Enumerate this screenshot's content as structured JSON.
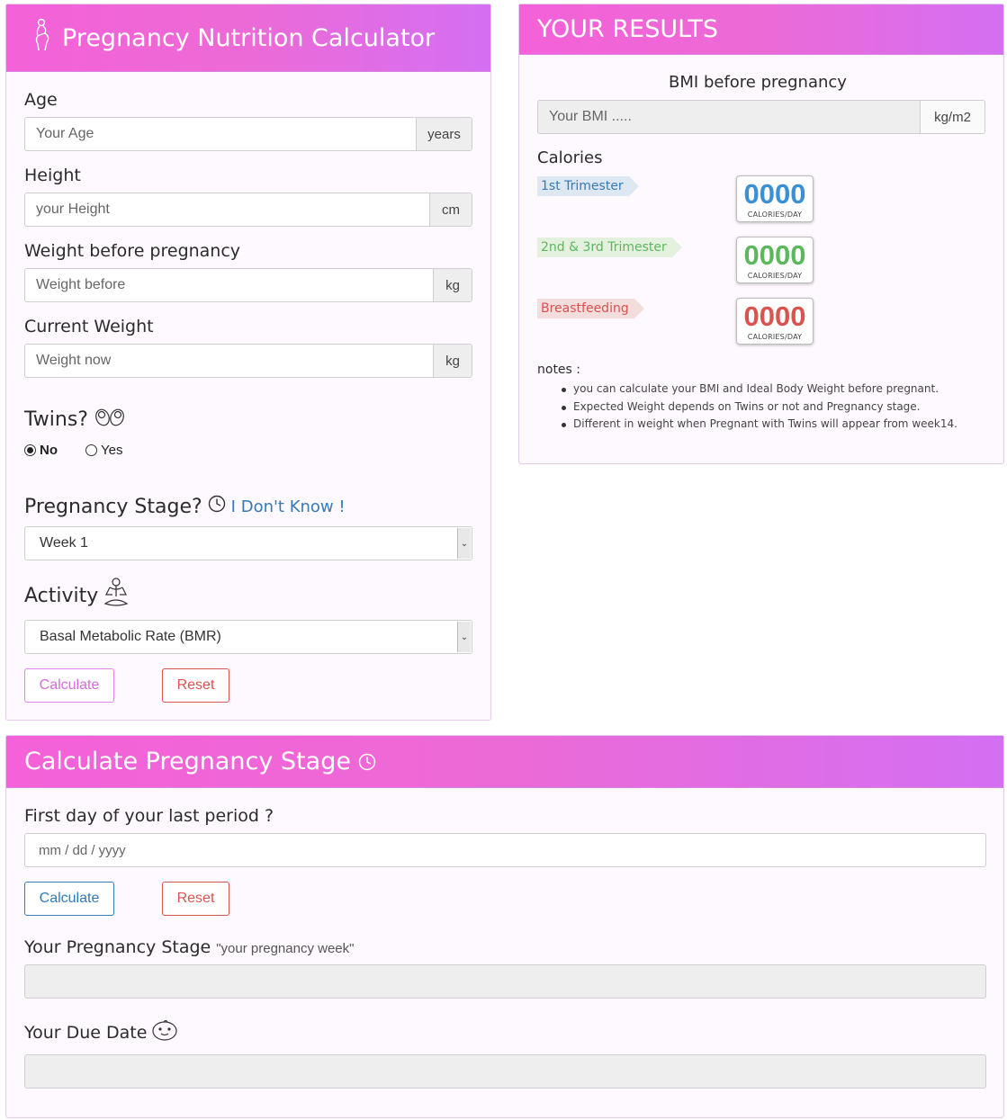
{
  "calculator": {
    "title": "Pregnancy Nutrition Calculator",
    "age": {
      "label": "Age",
      "placeholder": "Your Age",
      "unit": "years"
    },
    "height": {
      "label": "Height",
      "placeholder": "your Height",
      "unit": "cm"
    },
    "weight_before": {
      "label": "Weight before pregnancy",
      "placeholder": "Weight before",
      "unit": "kg"
    },
    "current_weight": {
      "label": "Current Weight",
      "placeholder": "Weight now",
      "unit": "kg"
    },
    "twins": {
      "label": "Twins?",
      "options": [
        "No",
        "Yes"
      ],
      "selected": "No"
    },
    "stage": {
      "label": "Pregnancy Stage?",
      "help_link": "I Don't Know !",
      "selected": "Week 1"
    },
    "activity": {
      "label": "Activity",
      "selected": "Basal Metabolic Rate (BMR)"
    },
    "calculate_label": "Calculate",
    "reset_label": "Reset"
  },
  "results": {
    "title": "YOUR RESULTS",
    "bmi_heading": "BMI before pregnancy",
    "bmi_placeholder": "Your BMI .....",
    "bmi_unit": "kg/m2",
    "calories_heading": "Calories",
    "calories": [
      {
        "label": "1st Trimester",
        "value": "0000",
        "unit": "CALORIES/DAY",
        "color": "#3b8fd3"
      },
      {
        "label": "2nd & 3rd Trimester",
        "value": "0000",
        "unit": "CALORIES/DAY",
        "color": "#5cb85c"
      },
      {
        "label": "Breastfeeding",
        "value": "0000",
        "unit": "CALORIES/DAY",
        "color": "#d9534f"
      }
    ],
    "notes_heading": "notes :",
    "notes": [
      "you can calculate your BMI and Ideal Body Weight before pregnant.",
      "Expected Weight depends on Twins or not and Pregnancy stage.",
      "Different in weight when Pregnant with Twins will appear from week14."
    ]
  },
  "stage_calc": {
    "title": "Calculate Pregnancy Stage",
    "period_label": "First day of your last period ?",
    "date_placeholder": "mm / dd / yyyy",
    "calculate_label": "Calculate",
    "reset_label": "Reset",
    "stage_label": "Your Pregnancy Stage",
    "stage_hint": "\"your pregnancy week\"",
    "due_label": "Your Due Date"
  }
}
